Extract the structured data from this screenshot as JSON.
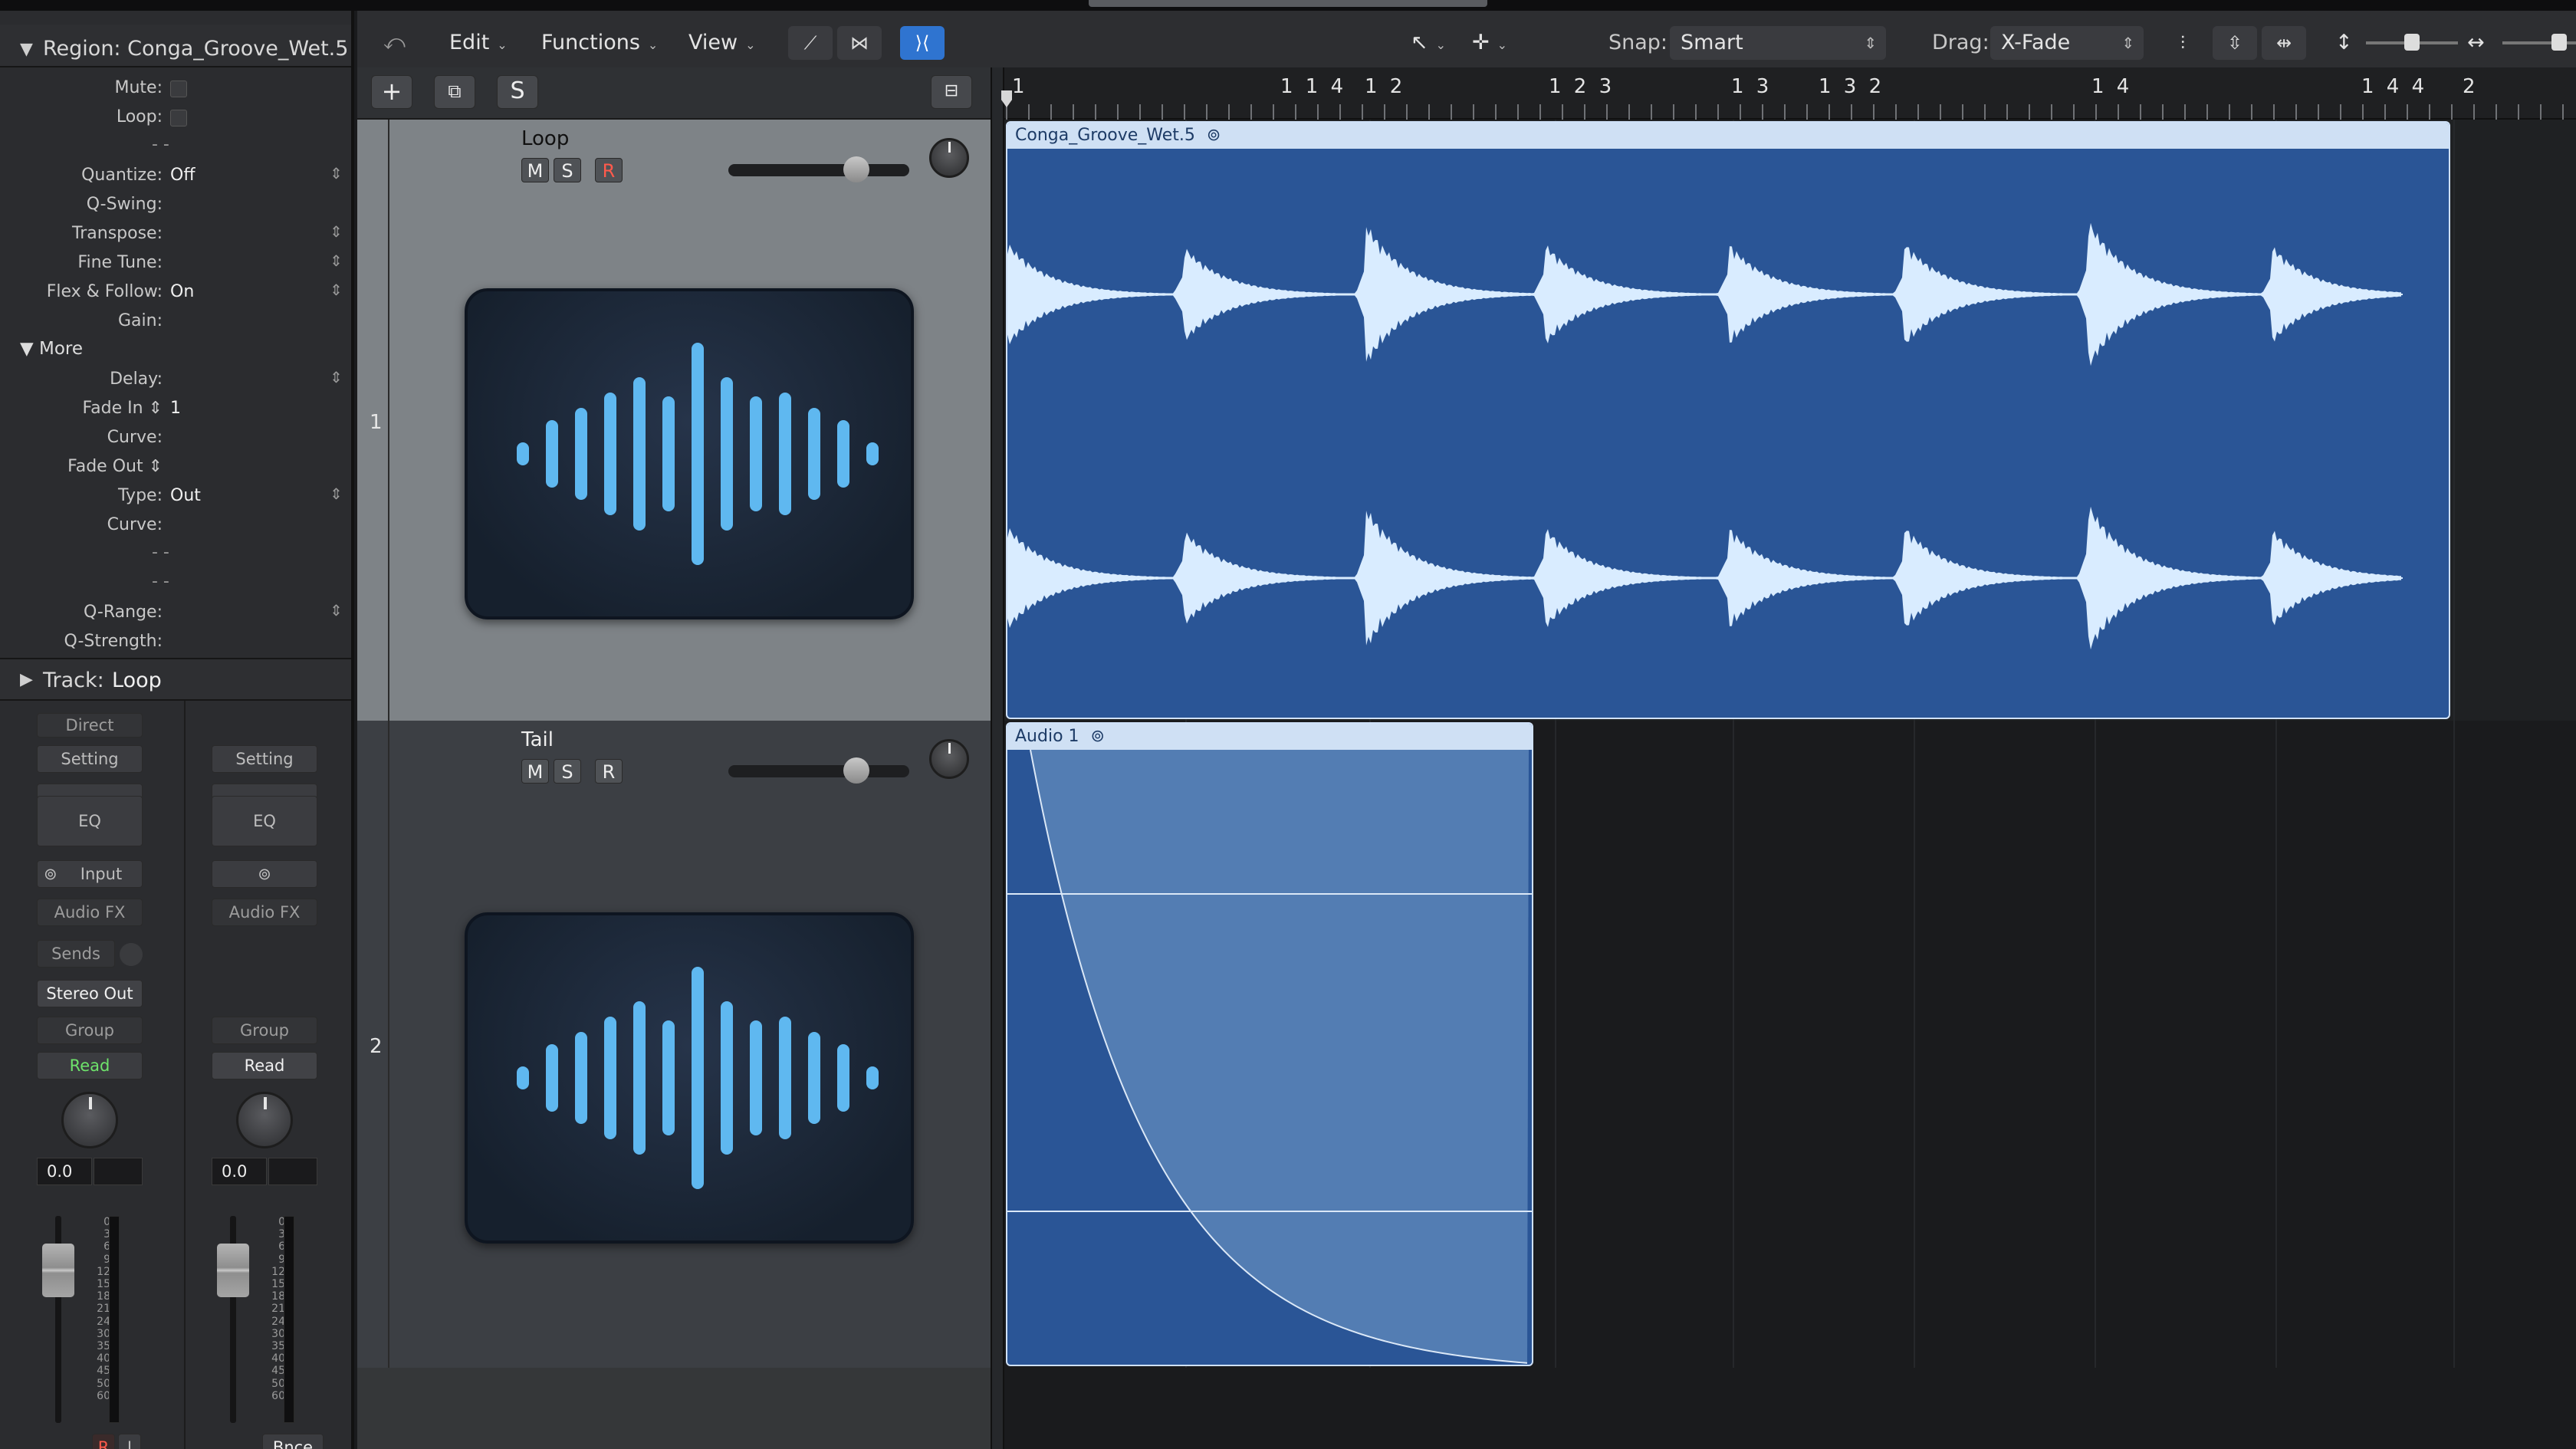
{
  "toolbar": {
    "menus": [
      "Edit",
      "Functions",
      "View"
    ],
    "snap_label": "Snap:",
    "snap_value": "Smart",
    "drag_label": "Drag:",
    "drag_value": "X-Fade"
  },
  "inspector": {
    "region_label": "Region:",
    "region_name": "Conga_Groove_Wet.5",
    "rows": [
      {
        "k": "Mute:",
        "v": "",
        "type": "check"
      },
      {
        "k": "Loop:",
        "v": "",
        "type": "check"
      },
      {
        "k": "",
        "v": "- -",
        "type": "dash"
      },
      {
        "k": "Quantize:",
        "v": "Off",
        "type": "updown"
      },
      {
        "k": "Q-Swing:",
        "v": "",
        "type": "text"
      },
      {
        "k": "Transpose:",
        "v": "",
        "type": "updown"
      },
      {
        "k": "Fine Tune:",
        "v": "",
        "type": "updown"
      },
      {
        "k": "Flex & Follow:",
        "v": "On",
        "type": "updown"
      },
      {
        "k": "Gain:",
        "v": "",
        "type": "text"
      }
    ],
    "more_label": "More",
    "more_rows": [
      {
        "k": "Delay:",
        "v": "",
        "type": "updown"
      },
      {
        "k": "Fade In ⇕",
        "v": "1",
        "type": "text"
      },
      {
        "k": "Curve:",
        "v": "",
        "type": "text"
      },
      {
        "k": "Fade Out ⇕",
        "v": "",
        "type": "text"
      },
      {
        "k": "Type:",
        "v": "Out",
        "type": "updown"
      },
      {
        "k": "Curve:",
        "v": "",
        "type": "text"
      },
      {
        "k": "",
        "v": "- -",
        "type": "dash"
      },
      {
        "k": "",
        "v": "- -",
        "type": "dash"
      },
      {
        "k": "Q-Range:",
        "v": "",
        "type": "updown"
      },
      {
        "k": "Q-Strength:",
        "v": "",
        "type": "text"
      }
    ],
    "track_label": "Track:",
    "track_name": "Loop"
  },
  "channel_strips": [
    {
      "direct": "Direct",
      "setting": "Setting",
      "eq": "EQ",
      "input": "Input",
      "audio_fx": "Audio FX",
      "sends": "Sends",
      "output": "Stereo Out",
      "group": "Group",
      "automation": "Read",
      "volume": "0.0",
      "bottom_r": "R",
      "bottom_i": "I"
    },
    {
      "setting": "Setting",
      "eq": "EQ",
      "audio_fx": "Audio FX",
      "group": "Group",
      "automation": "Read",
      "volume": "0.0",
      "bottom_label": "Bnce"
    }
  ],
  "meter_scale": [
    "0",
    "3",
    "6",
    "9",
    "12",
    "15",
    "18",
    "21",
    "24",
    "30",
    "35",
    "40",
    "45",
    "50",
    "60"
  ],
  "tracks": [
    {
      "number": "1",
      "name": "Loop",
      "m": "M",
      "s": "S",
      "r": "R"
    },
    {
      "number": "2",
      "name": "Tail",
      "m": "M",
      "s": "S",
      "r": "R"
    }
  ],
  "track_header_buttons": {
    "add": "+",
    "s": "S"
  },
  "ruler": {
    "marks": [
      "1",
      "1 1 4",
      "1 2",
      "1 2 3",
      "1 3",
      "1 3 2",
      "1 4",
      "1 4 4",
      "2"
    ]
  },
  "regions": [
    {
      "name": "Conga_Groove_Wet.5"
    },
    {
      "name": "Audio 1"
    }
  ],
  "colors": {
    "region_blue": "#2a5596",
    "waveform": "#d9ecff",
    "automation_read": "#6ee36b",
    "record_red": "#ff5a4c",
    "accent_blue": "#2f74d0"
  }
}
